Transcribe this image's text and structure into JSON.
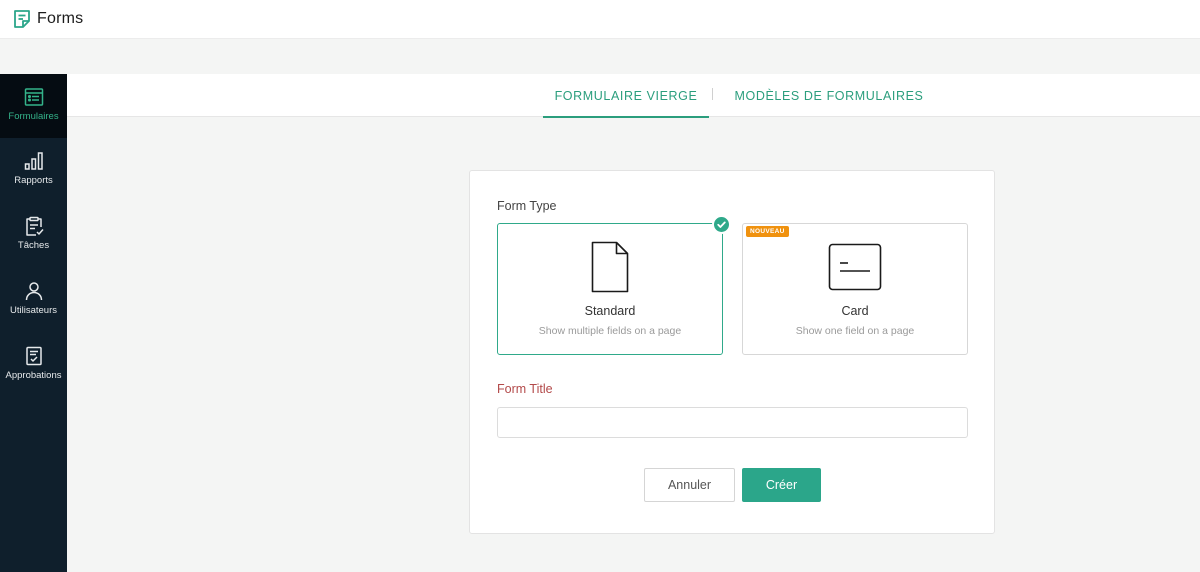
{
  "app": {
    "title": "Forms",
    "logo_icon": "forms-logo-icon",
    "accent": "#2b9e7d"
  },
  "sidebar": {
    "items": [
      {
        "label": "Formulaires",
        "icon": "form-list-icon",
        "active": true
      },
      {
        "label": "Rapports",
        "icon": "bar-chart-icon",
        "active": false
      },
      {
        "label": "Tâches",
        "icon": "clipboard-icon",
        "active": false
      },
      {
        "label": "Utilisateurs",
        "icon": "user-icon",
        "active": false
      },
      {
        "label": "Approbations",
        "icon": "approval-icon",
        "active": false
      }
    ]
  },
  "tabs": [
    {
      "label": "FORMULAIRE VIERGE",
      "active": true
    },
    {
      "label": "MODÈLES DE FORMULAIRES",
      "active": false
    }
  ],
  "panel": {
    "form_type_label": "Form Type",
    "cards": [
      {
        "title": "Standard",
        "description": "Show multiple fields on a page",
        "selected": true,
        "icon": "document-icon"
      },
      {
        "title": "Card",
        "description": "Show one field on a page",
        "selected": false,
        "badge": "NOUVEAU",
        "icon": "card-icon"
      }
    ],
    "form_title_label": "Form Title",
    "form_title_value": "",
    "form_title_placeholder": "",
    "cancel_label": "Annuler",
    "create_label": "Créer"
  }
}
